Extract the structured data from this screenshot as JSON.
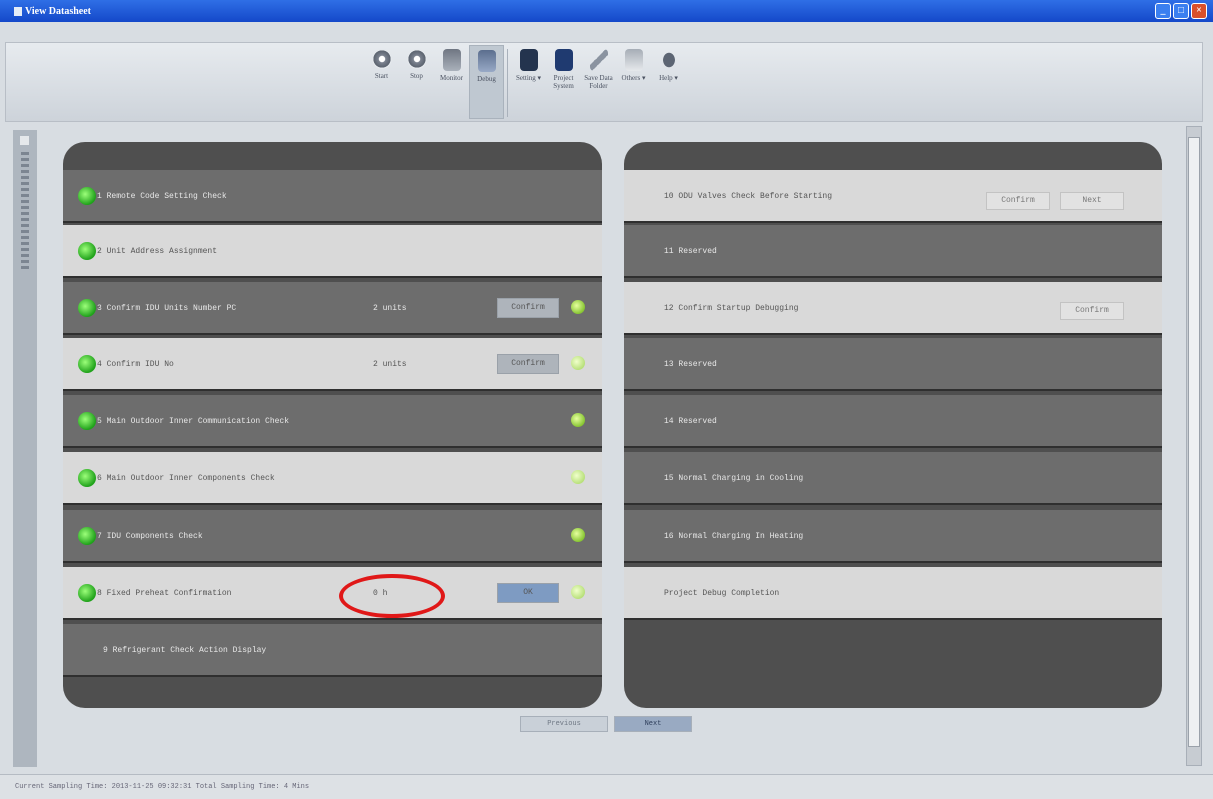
{
  "window": {
    "title": "View Datasheet",
    "controls": [
      "_",
      "□",
      "×"
    ]
  },
  "toolbar": {
    "buttons": [
      {
        "label": "Start",
        "icon": "play-icon"
      },
      {
        "label": "Stop",
        "icon": "stop-icon"
      },
      {
        "label": "Monitor",
        "icon": "monitor-icon"
      },
      {
        "label": "Debug",
        "icon": "debug-icon",
        "active": true
      },
      {
        "label": "Setting ▾",
        "icon": "settings-icon"
      },
      {
        "label": "Project System",
        "icon": "project-system-icon"
      },
      {
        "label": "Save Data Folder",
        "icon": "tool-icon"
      },
      {
        "label": "Others ▾",
        "icon": "picture-icon"
      },
      {
        "label": "Help ▾",
        "icon": "help-icon"
      }
    ]
  },
  "left_panel": {
    "rows": [
      {
        "label": "1 Remote Code Setting Check",
        "value": "",
        "button": "",
        "style": "dark"
      },
      {
        "label": "2 Unit Address Assignment",
        "value": "",
        "button": "",
        "style": "light"
      },
      {
        "label": "3 Confirm IDU Units Number PC",
        "value": "2 units",
        "button": "Confirm",
        "style": "dark"
      },
      {
        "label": "4 Confirm IDU No",
        "value": "2 units",
        "button": "Confirm",
        "style": "light"
      },
      {
        "label": "5 Main Outdoor Inner Communication Check",
        "value": "",
        "button": "",
        "style": "dark"
      },
      {
        "label": "6 Main Outdoor Inner Components Check",
        "value": "",
        "button": "",
        "style": "light"
      },
      {
        "label": "7 IDU Components Check",
        "value": "",
        "button": "",
        "style": "dark"
      },
      {
        "label": "8 Fixed Preheat Confirmation",
        "value": "0 h",
        "button": "OK",
        "style": "light"
      },
      {
        "label": "9 Refrigerant Check Action Display",
        "value": "",
        "button": "",
        "style": "dark"
      }
    ]
  },
  "right_panel": {
    "rows": [
      {
        "label": "10 ODU Valves Check Before Starting",
        "buttons": [
          "Confirm",
          "Next"
        ],
        "style": "light"
      },
      {
        "label": "11 Reserved",
        "buttons": [],
        "style": "dark"
      },
      {
        "label": "12 Confirm Startup Debugging",
        "buttons": [
          "Confirm"
        ],
        "style": "light"
      },
      {
        "label": "13 Reserved",
        "buttons": [],
        "style": "dark"
      },
      {
        "label": "14 Reserved",
        "buttons": [],
        "style": "dark"
      },
      {
        "label": "15 Normal Charging in Cooling",
        "buttons": [],
        "style": "dark"
      },
      {
        "label": "16 Normal Charging In Heating",
        "buttons": [],
        "style": "dark"
      },
      {
        "label": "Project Debug Completion",
        "buttons": [],
        "style": "light"
      }
    ]
  },
  "nav": {
    "previous_label": "Previous",
    "next_label": "Next"
  },
  "status_bar": {
    "text": "Current Sampling Time: 2013-11-25 09:32:31   Total Sampling Time: 4 Mins"
  }
}
